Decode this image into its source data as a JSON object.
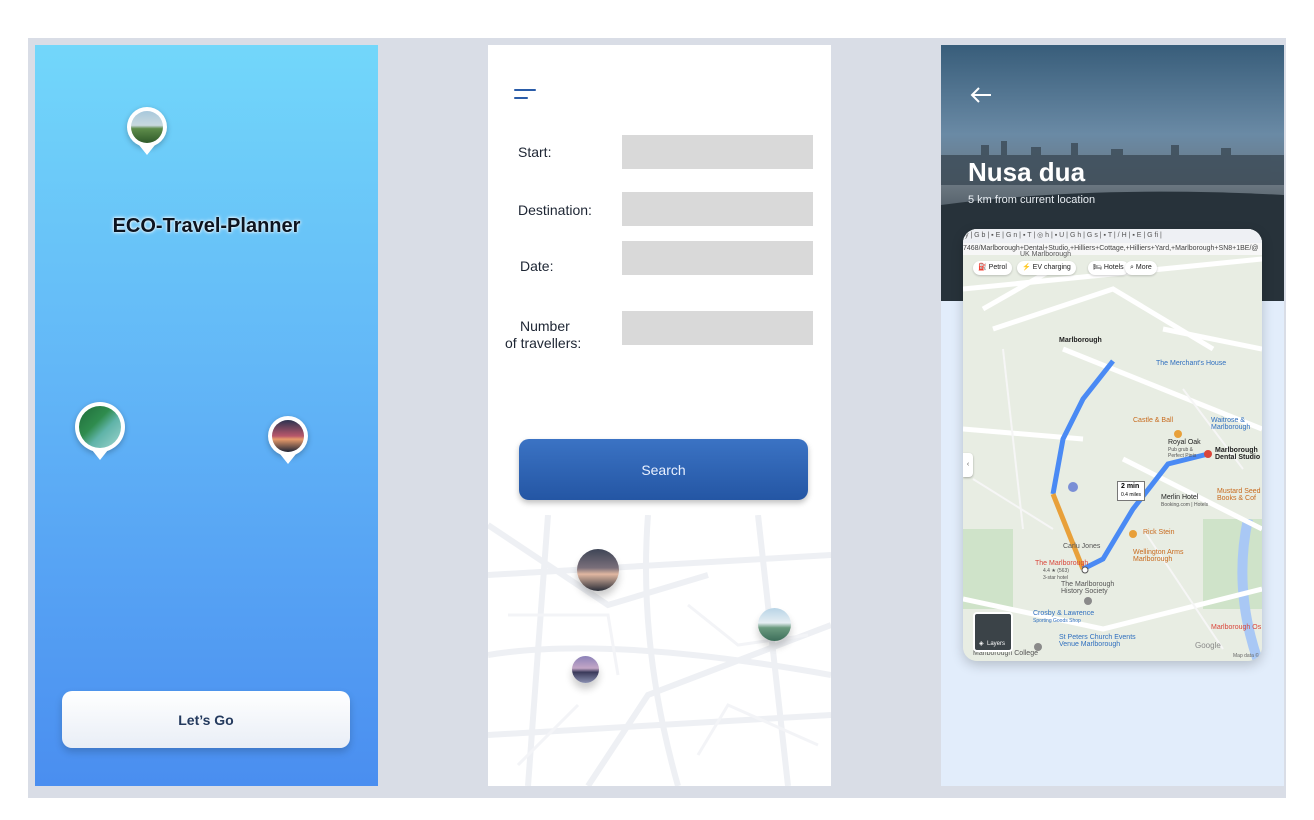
{
  "screen1": {
    "title": "ECO-Travel-Planner",
    "cta_label": "Let’s Go"
  },
  "screen2": {
    "fields": [
      {
        "label": "Start:"
      },
      {
        "label": "Destination:"
      },
      {
        "label": "Date:"
      },
      {
        "label": "Number\nof travellers:"
      }
    ],
    "label_number": "Number",
    "label_travellers": "of travellers:",
    "search_label": "Search"
  },
  "screen3": {
    "place_name": "Nusa dua",
    "distance_text": "5 km from current location",
    "map": {
      "url_text": "7468/Marlborough+Dental+Studio,+Hilliers+Cottage,+Hilliers+Yard,+Marlborough+SN8+1BE/@",
      "chips": [
        "Petrol",
        "EV charging",
        "Hotels",
        "More"
      ],
      "labels": {
        "uk_marlborough": "UK Marlborough",
        "marlborough": "Marlborough",
        "merchants_house": "The Merchant's House",
        "castle_ball": "Castle & Ball",
        "waitrose": "Waitrose & Marlborough",
        "royal_oak": "Royal Oak",
        "royal_oak_sub": "Pub grub & Perfect Pints",
        "dental_studio": "Marlborough Dental Studio",
        "duration": "2 min",
        "distance": "0.4 miles",
        "merlin_hotel": "Merlin Hotel",
        "merlin_sub": "Booking.com | Hotels",
        "mustard": "Mustard Seed Books & Cof",
        "rick_stein": "Rick Stein",
        "carluccio": "Carlu  Jones",
        "wellington": "Wellington Arms Marlborough",
        "the_marlborough": "The Marlborough",
        "rating": "4.4 ★ (563)",
        "star_hotel": "3-star hotel",
        "history_society": "The Marlborough History Society",
        "crosby": "Crosby & Lawrence",
        "crosby_sub": "Sporting Goods Shop",
        "st_peters": "St Peters Church Events Venue Marlborough",
        "marlborough_college": "Marlborough College",
        "marlborough_os": "Marlborough Os",
        "layers": "Layers",
        "google": "Google",
        "map_data": "Map data ©"
      }
    }
  },
  "colors": {
    "accent": "#2456a4",
    "route_blue": "#4a8af4",
    "route_orange": "#e8a03a"
  }
}
